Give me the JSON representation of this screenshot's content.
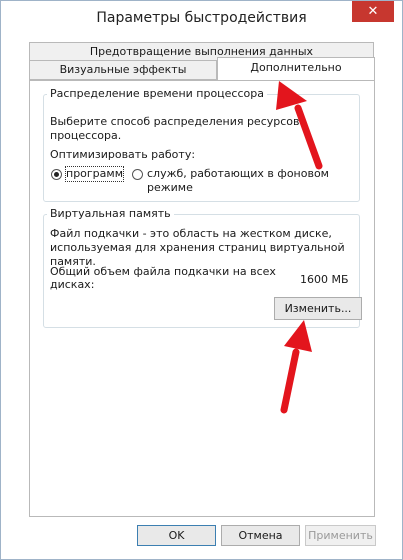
{
  "window": {
    "title": "Параметры быстродействия",
    "close_label": "✕"
  },
  "tabs": [
    {
      "label": "Предотвращение выполнения данных",
      "selected": false
    },
    {
      "label": "Визуальные эффекты",
      "selected": false
    },
    {
      "label": "Дополнительно",
      "selected": true
    }
  ],
  "processor_group": {
    "title": "Распределение времени процессора",
    "description": "Выберите способ распределения ресурсов процессора.",
    "optimize_label": "Оптимизировать работу:",
    "options": [
      {
        "label": "программ",
        "checked": true
      },
      {
        "label": "служб, работающих в фоновом режиме",
        "checked": false
      }
    ]
  },
  "virtual_memory_group": {
    "title": "Виртуальная память",
    "description_line1": "Файл подкачки - это область на жестком диске,",
    "description_line2": "используемая для хранения страниц виртуальной памяти.",
    "total_label_line1": "Общий объем файла подкачки на всех",
    "total_label_line2": "дисках:",
    "total_value": "1600 МБ",
    "change_button": "Изменить..."
  },
  "footer": {
    "ok": "OK",
    "cancel": "Отмена",
    "apply": "Применить"
  },
  "colors": {
    "annotation_arrow": "#e3151d",
    "close_button": "#c7372f"
  }
}
